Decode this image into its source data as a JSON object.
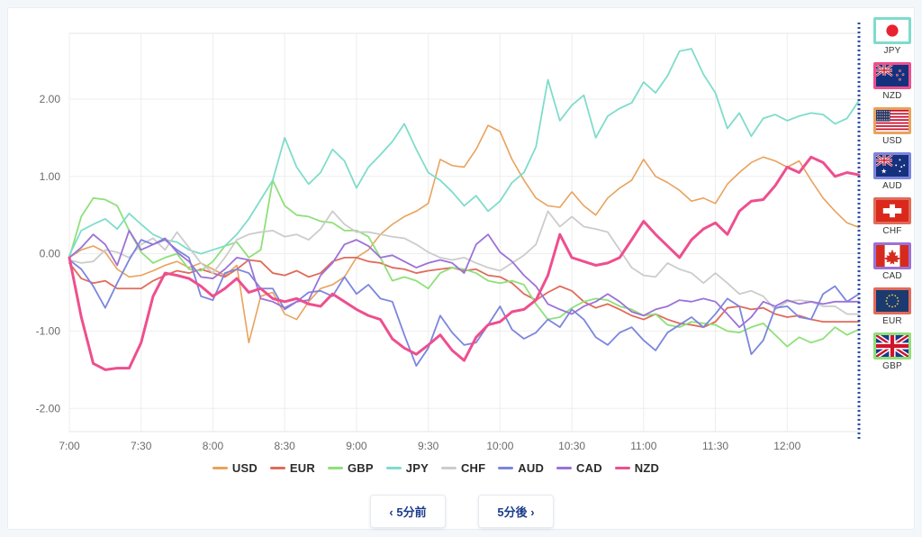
{
  "chart_data": {
    "type": "line",
    "title": "",
    "xlabel": "",
    "ylabel": "",
    "grid": true,
    "legend_position": "bottom",
    "ylim": [
      -2.3,
      2.85
    ],
    "yticks": [
      -2.0,
      -1.0,
      0.0,
      1.0,
      2.0
    ],
    "ytick_labels": [
      "-2.00",
      "-1.00",
      "0.00",
      "1.00",
      "2.00"
    ],
    "xlim": [
      "7:00",
      "12:35"
    ],
    "xticks": [
      "7:00",
      "7:30",
      "8:00",
      "8:30",
      "9:00",
      "9:30",
      "10:00",
      "10:30",
      "11:00",
      "11:30",
      "12:00"
    ],
    "x": [
      "7:00",
      "7:05",
      "7:10",
      "7:15",
      "7:20",
      "7:25",
      "7:30",
      "7:35",
      "7:40",
      "7:45",
      "7:50",
      "7:55",
      "8:00",
      "8:05",
      "8:10",
      "8:15",
      "8:20",
      "8:25",
      "8:30",
      "8:35",
      "8:40",
      "8:45",
      "8:50",
      "8:55",
      "9:00",
      "9:05",
      "9:10",
      "9:15",
      "9:20",
      "9:25",
      "9:30",
      "9:35",
      "9:40",
      "9:45",
      "9:50",
      "9:55",
      "10:00",
      "10:05",
      "10:10",
      "10:15",
      "10:20",
      "10:25",
      "10:30",
      "10:35",
      "10:40",
      "10:45",
      "10:50",
      "10:55",
      "11:00",
      "11:05",
      "11:10",
      "11:15",
      "11:20",
      "11:25",
      "11:30",
      "11:35",
      "11:40",
      "11:45",
      "11:50",
      "11:55",
      "12:00",
      "12:05",
      "12:10",
      "12:15",
      "12:20",
      "12:25",
      "12:30"
    ],
    "series": [
      {
        "name": "USD",
        "color": "#E9A25C",
        "width": 1.6,
        "values": [
          -0.05,
          0.05,
          0.1,
          0.02,
          -0.2,
          -0.3,
          -0.28,
          -0.22,
          -0.15,
          -0.1,
          -0.18,
          -0.12,
          -0.2,
          -0.28,
          -0.15,
          -1.15,
          -0.55,
          -0.5,
          -0.78,
          -0.85,
          -0.62,
          -0.45,
          -0.4,
          -0.3,
          -0.05,
          0.05,
          0.25,
          0.38,
          0.48,
          0.55,
          0.65,
          1.22,
          1.14,
          1.12,
          1.35,
          1.66,
          1.58,
          1.22,
          0.95,
          0.72,
          0.62,
          0.6,
          0.8,
          0.62,
          0.5,
          0.72,
          0.85,
          0.95,
          1.22,
          1.0,
          0.92,
          0.82,
          0.68,
          0.72,
          0.65,
          0.9,
          1.05,
          1.18,
          1.25,
          1.2,
          1.12,
          1.2,
          0.95,
          0.72,
          0.55,
          0.4,
          0.34
        ]
      },
      {
        "name": "EUR",
        "color": "#E06B5A",
        "width": 1.8,
        "values": [
          -0.12,
          -0.32,
          -0.38,
          -0.35,
          -0.45,
          -0.45,
          -0.45,
          -0.35,
          -0.28,
          -0.22,
          -0.25,
          -0.2,
          -0.25,
          -0.3,
          -0.2,
          -0.08,
          -0.1,
          -0.25,
          -0.28,
          -0.22,
          -0.3,
          -0.25,
          -0.1,
          -0.05,
          -0.05,
          -0.1,
          -0.12,
          -0.18,
          -0.2,
          -0.25,
          -0.22,
          -0.2,
          -0.18,
          -0.22,
          -0.2,
          -0.28,
          -0.3,
          -0.38,
          -0.52,
          -0.6,
          -0.5,
          -0.42,
          -0.48,
          -0.62,
          -0.7,
          -0.65,
          -0.72,
          -0.8,
          -0.85,
          -0.78,
          -0.85,
          -0.9,
          -0.92,
          -0.95,
          -0.88,
          -0.7,
          -0.68,
          -0.72,
          -0.7,
          -0.78,
          -0.82,
          -0.8,
          -0.85,
          -0.88,
          -0.88,
          -0.88,
          -0.88
        ]
      },
      {
        "name": "GBP",
        "color": "#8FE07A",
        "width": 1.8,
        "values": [
          -0.05,
          0.48,
          0.72,
          0.7,
          0.62,
          0.3,
          0.02,
          -0.12,
          -0.05,
          0.0,
          -0.2,
          -0.22,
          -0.1,
          0.1,
          0.15,
          -0.05,
          0.05,
          0.95,
          0.62,
          0.5,
          0.48,
          0.42,
          0.4,
          0.3,
          0.3,
          0.22,
          -0.05,
          -0.35,
          -0.3,
          -0.35,
          -0.45,
          -0.25,
          -0.18,
          -0.2,
          -0.25,
          -0.35,
          -0.38,
          -0.35,
          -0.4,
          -0.65,
          -0.85,
          -0.82,
          -0.7,
          -0.62,
          -0.58,
          -0.6,
          -0.68,
          -0.72,
          -0.8,
          -0.78,
          -0.92,
          -0.95,
          -0.88,
          -0.9,
          -0.92,
          -1.0,
          -1.02,
          -0.95,
          -0.9,
          -1.05,
          -1.2,
          -1.08,
          -1.15,
          -1.1,
          -0.95,
          -1.05,
          -0.98
        ]
      },
      {
        "name": "JPY",
        "color": "#7FDCCB",
        "width": 1.8,
        "values": [
          -0.02,
          0.3,
          0.38,
          0.45,
          0.32,
          0.52,
          0.38,
          0.25,
          0.18,
          0.15,
          0.05,
          0.0,
          0.05,
          0.1,
          0.25,
          0.45,
          0.7,
          0.95,
          1.5,
          1.12,
          0.9,
          1.05,
          1.35,
          1.2,
          0.85,
          1.12,
          1.28,
          1.45,
          1.68,
          1.35,
          1.05,
          0.95,
          0.8,
          0.62,
          0.75,
          0.55,
          0.68,
          0.92,
          1.05,
          1.38,
          2.25,
          1.72,
          1.92,
          2.05,
          1.5,
          1.78,
          1.88,
          1.95,
          2.22,
          2.08,
          2.3,
          2.62,
          2.65,
          2.32,
          2.08,
          1.62,
          1.82,
          1.52,
          1.75,
          1.8,
          1.72,
          1.78,
          1.82,
          1.8,
          1.68,
          1.75,
          1.98
        ]
      },
      {
        "name": "CHF",
        "color": "#CCCCCC",
        "width": 1.8,
        "values": [
          -0.08,
          -0.12,
          -0.1,
          0.05,
          0.02,
          -0.05,
          0.12,
          0.2,
          0.05,
          0.28,
          0.08,
          -0.12,
          -0.25,
          -0.05,
          0.18,
          0.25,
          0.28,
          0.3,
          0.22,
          0.25,
          0.18,
          0.32,
          0.55,
          0.38,
          0.28,
          0.28,
          0.25,
          0.22,
          0.2,
          0.12,
          0.02,
          -0.05,
          -0.08,
          -0.05,
          -0.12,
          -0.18,
          -0.22,
          -0.12,
          -0.02,
          0.12,
          0.55,
          0.35,
          0.48,
          0.35,
          0.32,
          0.28,
          0.05,
          -0.18,
          -0.28,
          -0.3,
          -0.12,
          -0.2,
          -0.25,
          -0.38,
          -0.25,
          -0.38,
          -0.52,
          -0.48,
          -0.55,
          -0.72,
          -0.62,
          -0.6,
          -0.62,
          -0.68,
          -0.68,
          -0.78,
          -0.78
        ]
      },
      {
        "name": "AUD",
        "color": "#7B86DD",
        "width": 1.8,
        "values": [
          -0.08,
          -0.2,
          -0.42,
          -0.7,
          -0.38,
          -0.08,
          0.18,
          0.12,
          0.18,
          0.05,
          -0.05,
          -0.55,
          -0.6,
          -0.25,
          -0.2,
          -0.25,
          -0.45,
          -0.45,
          -0.72,
          -0.62,
          -0.5,
          -0.48,
          -0.55,
          -0.3,
          -0.52,
          -0.4,
          -0.58,
          -0.62,
          -1.05,
          -1.45,
          -1.22,
          -0.8,
          -1.02,
          -1.18,
          -1.15,
          -0.92,
          -0.68,
          -0.98,
          -1.1,
          -1.02,
          -0.85,
          -0.95,
          -0.72,
          -0.85,
          -1.08,
          -1.18,
          -1.02,
          -0.95,
          -1.12,
          -1.25,
          -1.02,
          -0.92,
          -0.82,
          -0.95,
          -0.78,
          -0.58,
          -0.68,
          -1.3,
          -1.12,
          -0.7,
          -0.68,
          -0.82,
          -0.85,
          -0.52,
          -0.42,
          -0.62,
          -0.52
        ]
      },
      {
        "name": "CAD",
        "color": "#9B72D8",
        "width": 1.8,
        "values": [
          -0.05,
          0.08,
          0.25,
          0.12,
          -0.15,
          0.3,
          0.05,
          0.12,
          0.2,
          0.02,
          -0.1,
          -0.3,
          -0.32,
          -0.2,
          -0.05,
          -0.08,
          -0.58,
          -0.62,
          -0.7,
          -0.62,
          -0.6,
          -0.28,
          -0.12,
          0.12,
          0.18,
          0.1,
          -0.05,
          -0.02,
          -0.1,
          -0.18,
          -0.12,
          -0.08,
          -0.12,
          -0.25,
          0.12,
          0.25,
          0.02,
          -0.1,
          -0.28,
          -0.42,
          -0.65,
          -0.72,
          -0.78,
          -0.68,
          -0.62,
          -0.52,
          -0.62,
          -0.75,
          -0.8,
          -0.72,
          -0.68,
          -0.6,
          -0.62,
          -0.58,
          -0.62,
          -0.78,
          -0.95,
          -0.82,
          -0.62,
          -0.68,
          -0.6,
          -0.65,
          -0.62,
          -0.65,
          -0.62,
          -0.62,
          -0.62
        ]
      },
      {
        "name": "NZD",
        "color": "#EE4F8E",
        "width": 3.0,
        "values": [
          -0.05,
          -0.82,
          -1.42,
          -1.5,
          -1.48,
          -1.48,
          -1.15,
          -0.55,
          -0.25,
          -0.28,
          -0.32,
          -0.42,
          -0.55,
          -0.45,
          -0.32,
          -0.5,
          -0.45,
          -0.58,
          -0.62,
          -0.58,
          -0.65,
          -0.68,
          -0.52,
          -0.62,
          -0.72,
          -0.8,
          -0.85,
          -1.1,
          -1.22,
          -1.3,
          -1.18,
          -1.05,
          -1.25,
          -1.38,
          -1.08,
          -0.92,
          -0.88,
          -0.75,
          -0.72,
          -0.6,
          -0.28,
          0.25,
          -0.05,
          -0.1,
          -0.15,
          -0.12,
          -0.05,
          0.18,
          0.42,
          0.25,
          0.1,
          -0.05,
          0.18,
          0.32,
          0.4,
          0.25,
          0.55,
          0.68,
          0.7,
          0.88,
          1.12,
          1.05,
          1.25,
          1.18,
          1.0,
          1.05,
          1.02
        ]
      }
    ]
  },
  "legend": {
    "items": [
      {
        "label": "USD",
        "color": "#E9A25C"
      },
      {
        "label": "EUR",
        "color": "#E06B5A"
      },
      {
        "label": "GBP",
        "color": "#8FE07A"
      },
      {
        "label": "JPY",
        "color": "#7FDCCB"
      },
      {
        "label": "CHF",
        "color": "#CCCCCC"
      },
      {
        "label": "AUD",
        "color": "#7B86DD"
      },
      {
        "label": "CAD",
        "color": "#9B72D8"
      },
      {
        "label": "NZD",
        "color": "#EE4F8E"
      }
    ]
  },
  "ranking": {
    "items": [
      {
        "code": "JPY",
        "flag": "flag-jp",
        "border": "#7FDCCB"
      },
      {
        "code": "NZD",
        "flag": "flag-nz",
        "border": "#EE4F8E"
      },
      {
        "code": "USD",
        "flag": "flag-us",
        "border": "#E9A25C"
      },
      {
        "code": "AUD",
        "flag": "flag-au",
        "border": "#7B86DD"
      },
      {
        "code": "CHF",
        "flag": "flag-ch",
        "border": "#E06B5A"
      },
      {
        "code": "CAD",
        "flag": "flag-ca",
        "border": "#9B72D8"
      },
      {
        "code": "EUR",
        "flag": "flag-eu",
        "border": "#E06B5A"
      },
      {
        "code": "GBP",
        "flag": "flag-gb",
        "border": "#8FE07A"
      }
    ]
  },
  "nav": {
    "prev_label": "‹ 5分前",
    "next_label": "5分後 ›"
  },
  "colors": {
    "page_bg": "#f4f7fa",
    "card_bg": "#ffffff",
    "grid": "#ededed",
    "axis_text": "#6b6b6b",
    "marker_line": "#2b4fa8",
    "nav_text": "#1b3b8b"
  }
}
